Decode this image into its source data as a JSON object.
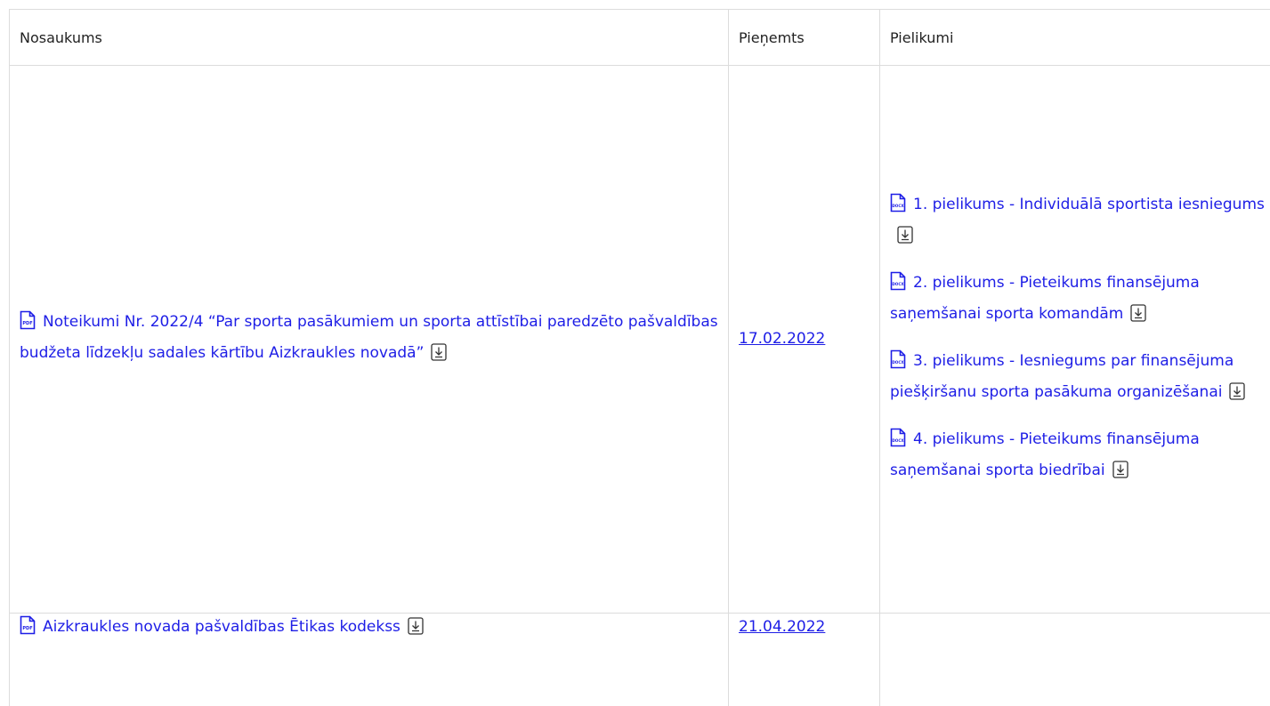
{
  "table": {
    "headers": {
      "name": "Nosaukums",
      "date": "Pieņemts",
      "attachments": "Pielikumi"
    },
    "rows": [
      {
        "name": "Noteikumi Nr. 2022/4 “Par sporta pasākumiem un sporta attīstībai paredzēto pašvaldības budžeta līdzekļu sadales kārtību Aizkraukles novadā”",
        "file_type": "PDF",
        "date": "17.02.2022",
        "attachments": [
          {
            "label": "1. pielikums - Individuālā sportista iesniegums",
            "file_type": "DOCX"
          },
          {
            "label": "2. pielikums - Pieteikums finansējuma saņemšanai sporta komandām",
            "file_type": "DOCX"
          },
          {
            "label": "3. pielikums - Iesniegums par finansējuma piešķiršanu sporta pasākuma organizēšanai",
            "file_type": "DOCX"
          },
          {
            "label": "4. pielikums - Pieteikums finansējuma saņemšanai sporta biedrībai",
            "file_type": "DOCX"
          }
        ]
      },
      {
        "name": "Aizkraukles novada pašvaldības Ētikas kodekss",
        "file_type": "PDF",
        "date": "21.04.2022",
        "attachments": []
      }
    ]
  },
  "colors": {
    "link": "#1e1ee6",
    "border": "#dcdcdc"
  },
  "icons": {
    "file": "document-file-icon",
    "download": "download-icon"
  }
}
